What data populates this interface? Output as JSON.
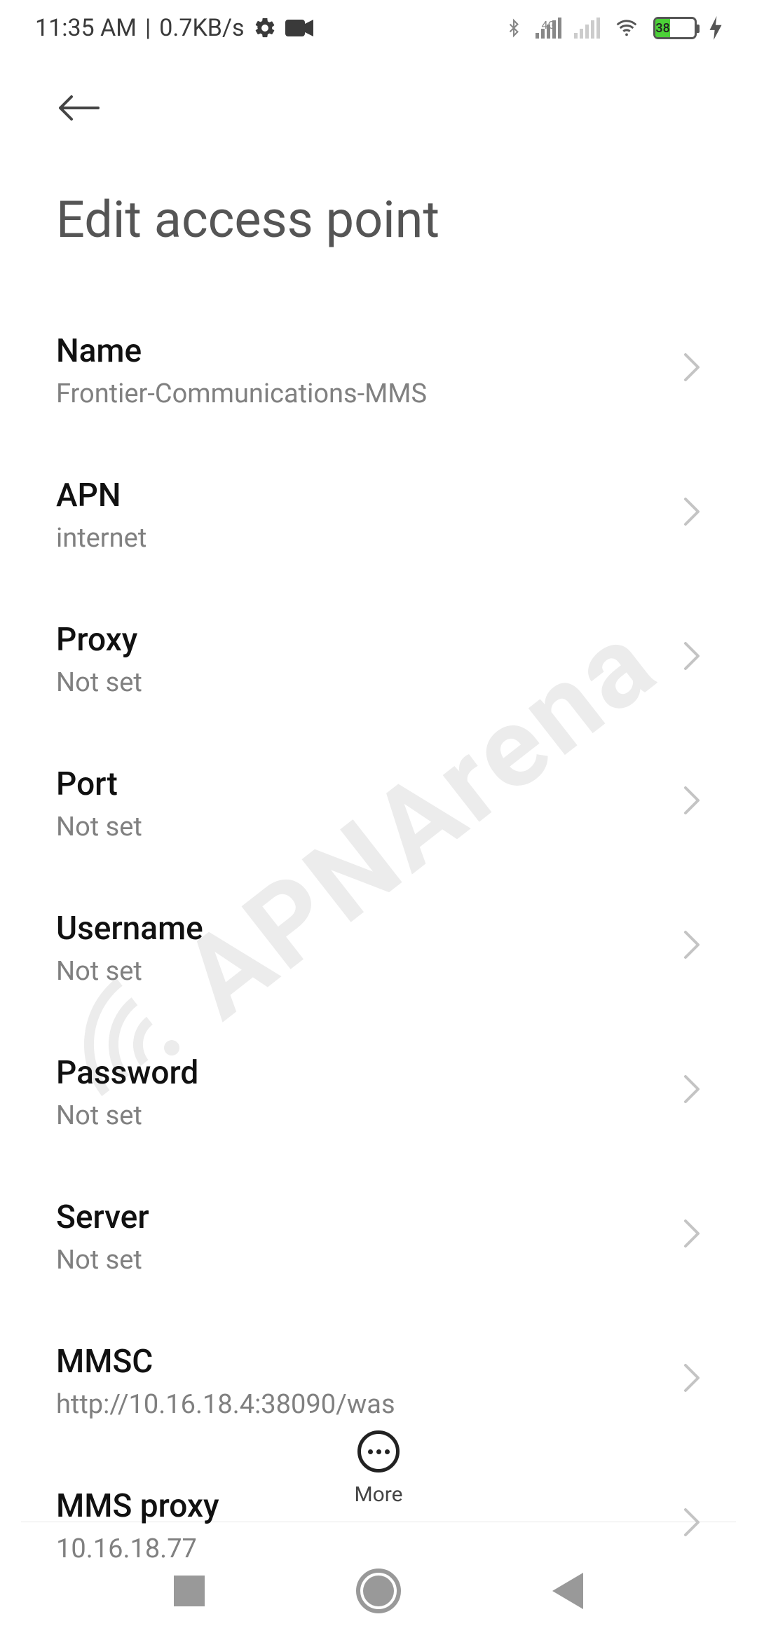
{
  "status_bar": {
    "time": "11:35 AM",
    "separator": "|",
    "net_speed": "0.7KB/s",
    "cell_label": "4G",
    "battery_percent": "38",
    "charging": true
  },
  "page": {
    "title": "Edit access point"
  },
  "settings": [
    {
      "label": "Name",
      "value": "Frontier-Communications-MMS"
    },
    {
      "label": "APN",
      "value": "internet"
    },
    {
      "label": "Proxy",
      "value": "Not set"
    },
    {
      "label": "Port",
      "value": "Not set"
    },
    {
      "label": "Username",
      "value": "Not set"
    },
    {
      "label": "Password",
      "value": "Not set"
    },
    {
      "label": "Server",
      "value": "Not set"
    },
    {
      "label": "MMSC",
      "value": "http://10.16.18.4:38090/was"
    },
    {
      "label": "MMS proxy",
      "value": "10.16.18.77"
    }
  ],
  "more_label": "More",
  "watermark": "APNArena"
}
